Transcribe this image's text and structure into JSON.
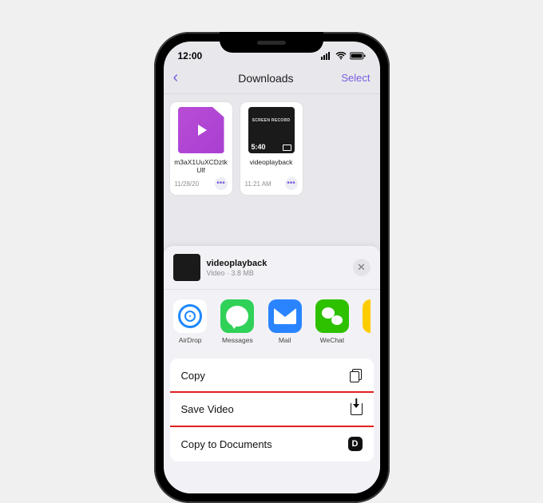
{
  "status": {
    "time": "12:00"
  },
  "nav": {
    "title": "Downloads",
    "select": "Select"
  },
  "files": [
    {
      "name": "m3aX1UuXCDztkUlf",
      "date": "11/28/20",
      "duration": ""
    },
    {
      "name": "videoplayback",
      "date": "11:21 AM",
      "duration": "5:40",
      "logo": "SCREEN RECORD"
    }
  ],
  "sheet": {
    "title": "videoplayback",
    "subtitle": "Video · 3.8 MB"
  },
  "apps": [
    {
      "label": "AirDrop"
    },
    {
      "label": "Messages"
    },
    {
      "label": "Mail"
    },
    {
      "label": "WeChat"
    }
  ],
  "actions": {
    "copy": "Copy",
    "save": "Save Video",
    "docs": "Copy to Documents"
  }
}
